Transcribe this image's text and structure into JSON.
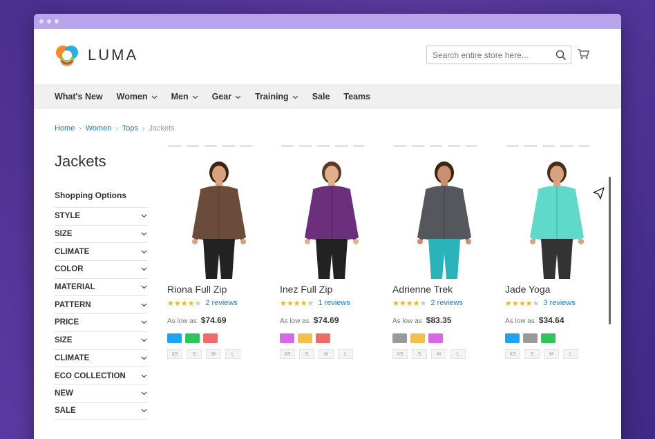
{
  "brand": {
    "name": "LUMA"
  },
  "search": {
    "placeholder": "Search entire store here..."
  },
  "nav": [
    {
      "label": "What's New",
      "dropdown": false
    },
    {
      "label": "Women",
      "dropdown": true
    },
    {
      "label": "Men",
      "dropdown": true
    },
    {
      "label": "Gear",
      "dropdown": true
    },
    {
      "label": "Training",
      "dropdown": true
    },
    {
      "label": "Sale",
      "dropdown": false
    },
    {
      "label": "Teams",
      "dropdown": false
    }
  ],
  "breadcrumb": {
    "home": "Home",
    "women": "Women",
    "tops": "Tops",
    "current": "Jackets"
  },
  "page": {
    "title": "Jackets"
  },
  "sidebar": {
    "title": "Shopping Options",
    "filters": [
      "STYLE",
      "SIZE",
      "CLIMATE",
      "COLOR",
      "MATERIAL",
      "PATTERN",
      "PRICE",
      "SIZE",
      "CLIMATE",
      "ECO COLLECTION",
      "NEW",
      "SALE"
    ]
  },
  "products": [
    {
      "name": "Riona Full Zip",
      "rating": 4,
      "reviews": "2 reviews",
      "price_label": "As low as",
      "price": "$74.69",
      "swatches": [
        "#1fa3f0",
        "#2ec65a",
        "#ef6b6b"
      ],
      "sizes": [
        "XS",
        "S",
        "M",
        "L"
      ],
      "jacket_color": "#6b4c3b",
      "skin": "#d8a27e",
      "pants": "#222222",
      "hair": "#3a2518"
    },
    {
      "name": "Inez Full Zip",
      "rating": 4,
      "reviews": "1 reviews",
      "price_label": "As low as",
      "price": "$74.69",
      "swatches": [
        "#d667e6",
        "#f2c04d",
        "#ef6b6b"
      ],
      "sizes": [
        "XS",
        "S",
        "M",
        "L"
      ],
      "jacket_color": "#6c2f7c",
      "skin": "#e0b08d",
      "pants": "#222222",
      "hair": "#5a3a24"
    },
    {
      "name": "Adrienne Trek",
      "rating": 4,
      "reviews": "2 reviews",
      "price_label": "As low as",
      "price": "$83.35",
      "swatches": [
        "#9a9a9a",
        "#f2c04d",
        "#d667e6"
      ],
      "sizes": [
        "XS",
        "S",
        "M",
        "L"
      ],
      "jacket_color": "#55575c",
      "skin": "#c98f6e",
      "pants": "#2ab3b8",
      "hair": "#3b2416"
    },
    {
      "name": "Jade Yoga",
      "rating": 4,
      "reviews": "3 reviews",
      "price_label": "As low as",
      "price": "$34.64",
      "swatches": [
        "#1fa3f0",
        "#9a9a9a",
        "#2ec65a"
      ],
      "sizes": [
        "XS",
        "S",
        "M",
        "L"
      ],
      "jacket_color": "#5fd9c9",
      "skin": "#d8a27e",
      "pants": "#333333",
      "hair": "#4a2c1a"
    }
  ]
}
